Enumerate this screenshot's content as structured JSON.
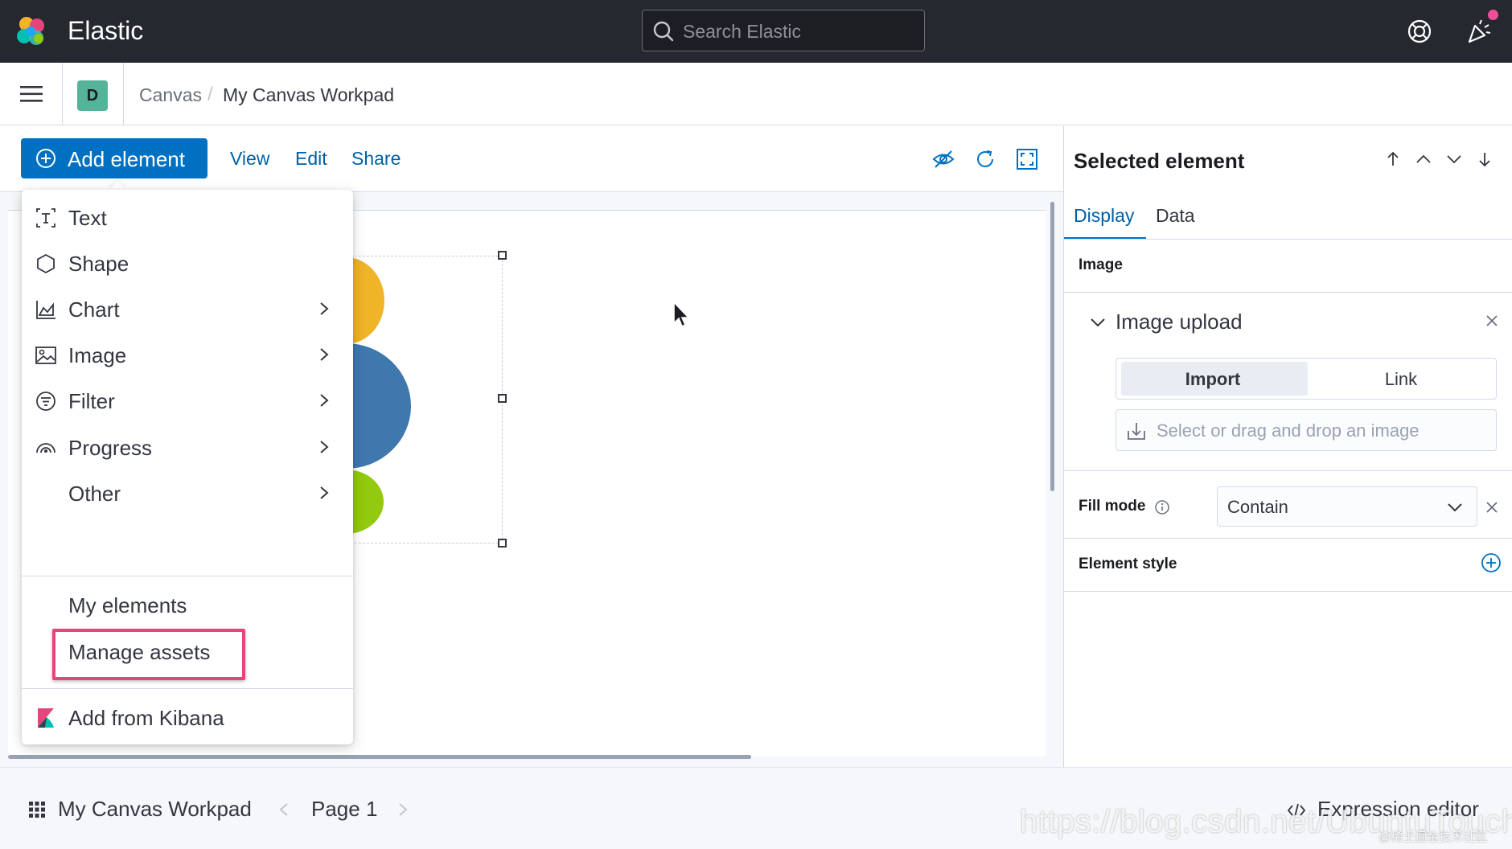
{
  "header": {
    "brand": "Elastic",
    "search_placeholder": "Search Elastic",
    "icons": [
      "elastic-logo-icon",
      "search-icon",
      "help-lifebuoy-icon",
      "newsfeed-cheer-icon"
    ]
  },
  "breadcrumb": {
    "space_initial": "D",
    "items": [
      "Canvas",
      "My Canvas Workpad"
    ],
    "separator": "/"
  },
  "toolbar": {
    "add_element_label": "Add element",
    "menus": [
      "View",
      "Edit",
      "Share"
    ],
    "icons": [
      "eye-closed-icon",
      "refresh-icon",
      "fullscreen-icon"
    ]
  },
  "add_menu": {
    "items": [
      {
        "label": "Text",
        "icon": "text-icon",
        "has_submenu": false
      },
      {
        "label": "Shape",
        "icon": "shape-icon",
        "has_submenu": false
      },
      {
        "label": "Chart",
        "icon": "chart-icon",
        "has_submenu": true
      },
      {
        "label": "Image",
        "icon": "image-icon",
        "has_submenu": true
      },
      {
        "label": "Filter",
        "icon": "filter-icon",
        "has_submenu": true
      },
      {
        "label": "Progress",
        "icon": "progress-icon",
        "has_submenu": true
      },
      {
        "label": "Other",
        "icon": "",
        "has_submenu": true
      }
    ],
    "my_elements": "My elements",
    "manage_assets": "Manage assets",
    "add_from_kibana": "Add from Kibana"
  },
  "sidebar": {
    "title": "Selected element",
    "tabs": [
      "Display",
      "Data"
    ],
    "active_tab": "Display",
    "section_image": "Image",
    "image_upload_title": "Image upload",
    "segmented": {
      "import": "Import",
      "link": "Link",
      "selected": "Import"
    },
    "file_picker_placeholder": "Select or drag and drop an image",
    "fill_mode_label": "Fill mode",
    "fill_mode_value": "Contain",
    "element_style_label": "Element style"
  },
  "footer": {
    "workpad_name": "My Canvas Workpad",
    "page_label": "Page 1",
    "expression_editor": "Expression editor"
  },
  "watermark": {
    "url": "https://blog.csdn.net/UbuntuTouch",
    "credit": "@稀土掘金技术社区"
  },
  "colors": {
    "header_bg": "#25282f",
    "primary": "#0071c2",
    "link": "#0061a6",
    "highlight": "#e5457c",
    "space_badge": "#54b399"
  }
}
